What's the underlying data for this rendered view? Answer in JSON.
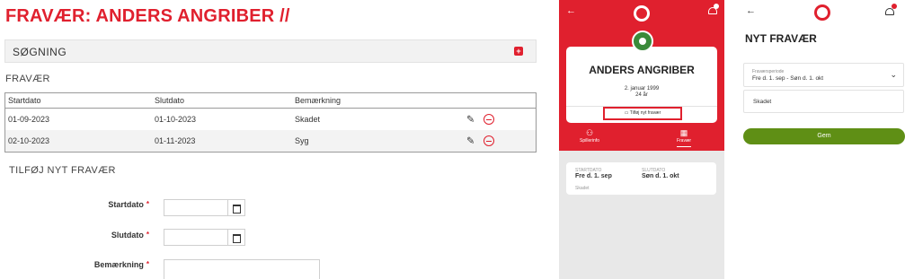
{
  "desktop": {
    "title": "FRAVÆR: ANDERS ANGRIBER //",
    "search_label": "SØGNING",
    "search_toggle": "+",
    "section": "FRAVÆR",
    "table": {
      "headers": [
        "Startdato",
        "Slutdato",
        "Bemærkning"
      ],
      "rows": [
        {
          "start": "01-09-2023",
          "end": "01-10-2023",
          "note": "Skadet"
        },
        {
          "start": "02-10-2023",
          "end": "01-11-2023",
          "note": "Syg"
        }
      ]
    },
    "add_title": "TILFØJ NYT FRAVÆR",
    "form": {
      "start_label": "Startdato",
      "end_label": "Slutdato",
      "note_label": "Bemærkning",
      "required_mark": "*"
    }
  },
  "mobile_profile": {
    "player_name": "ANDERS ANGRIBER",
    "birth_date": "2. januar 1999",
    "age": "24 år",
    "add_absence": "Tilføj nyt fravær",
    "tabs": [
      "Spillerinfo",
      "Fravær"
    ],
    "active_tab": "Fravær",
    "entry": {
      "start_key": "STARTDATO",
      "start_value": "Fre d. 1. sep",
      "end_key": "SLUTDATO",
      "end_value": "Søn d. 1. okt",
      "note": "Skadet"
    },
    "brand_color": "#e0202e"
  },
  "mobile_new": {
    "title": "NYT FRAVÆR",
    "period_label": "Fraværsperiode",
    "period_value": "Fre d. 1. sep - Søn d. 1. okt",
    "note_value": "Skadet",
    "save_label": "Gem",
    "save_color": "#5f8f15"
  }
}
